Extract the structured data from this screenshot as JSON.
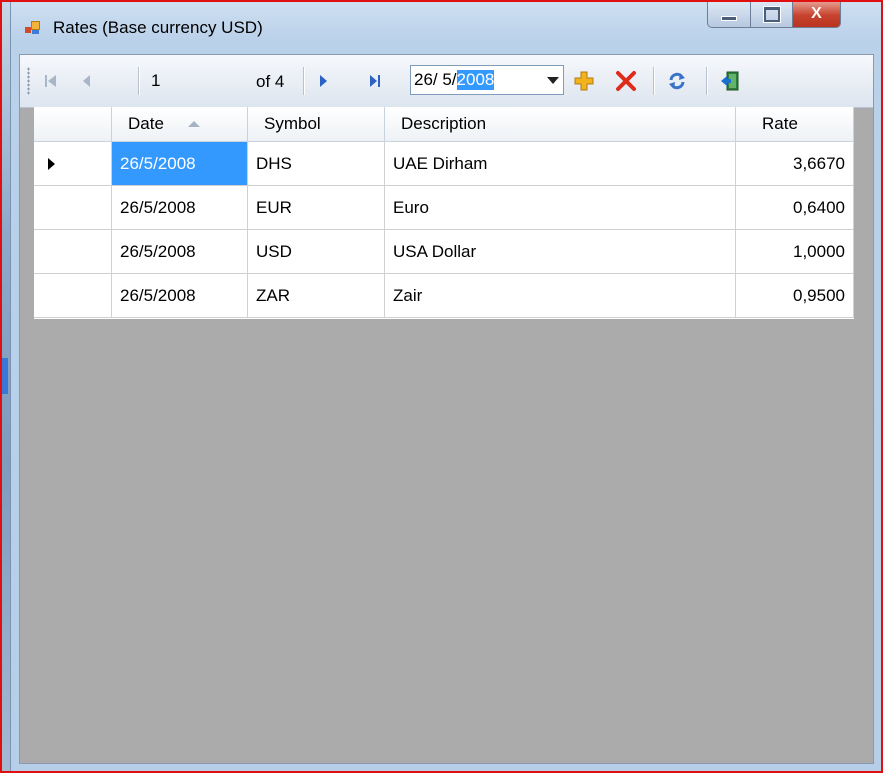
{
  "window": {
    "title": "Rates (Base currency USD)",
    "close_label": "X"
  },
  "navigator": {
    "position": "1",
    "count_label": "of 4",
    "date_value": {
      "day_month": "26/  5/",
      "year_selected": "2008"
    }
  },
  "grid": {
    "columns": [
      "Date",
      "Symbol",
      "Description",
      "Rate"
    ],
    "sorted_column": "Date",
    "rows": [
      {
        "date": "26/5/2008",
        "symbol": "DHS",
        "description": "UAE Dirham",
        "rate": "3,6670",
        "current": true
      },
      {
        "date": "26/5/2008",
        "symbol": "EUR",
        "description": "Euro",
        "rate": "0,6400"
      },
      {
        "date": "26/5/2008",
        "symbol": "USD",
        "description": "USA Dollar",
        "rate": "1,0000"
      },
      {
        "date": "26/5/2008",
        "symbol": "ZAR",
        "description": "Zair",
        "rate": "0,9500"
      }
    ]
  },
  "colors": {
    "selection": "#3399ff",
    "add_icon": "#f2b21c",
    "delete_icon": "#e02a1a",
    "frame_red": "#e01010"
  },
  "icons": [
    "move-first-icon",
    "move-previous-icon",
    "move-next-icon",
    "move-last-icon",
    "add-new-icon",
    "delete-icon",
    "refresh-icon",
    "exit-icon"
  ]
}
